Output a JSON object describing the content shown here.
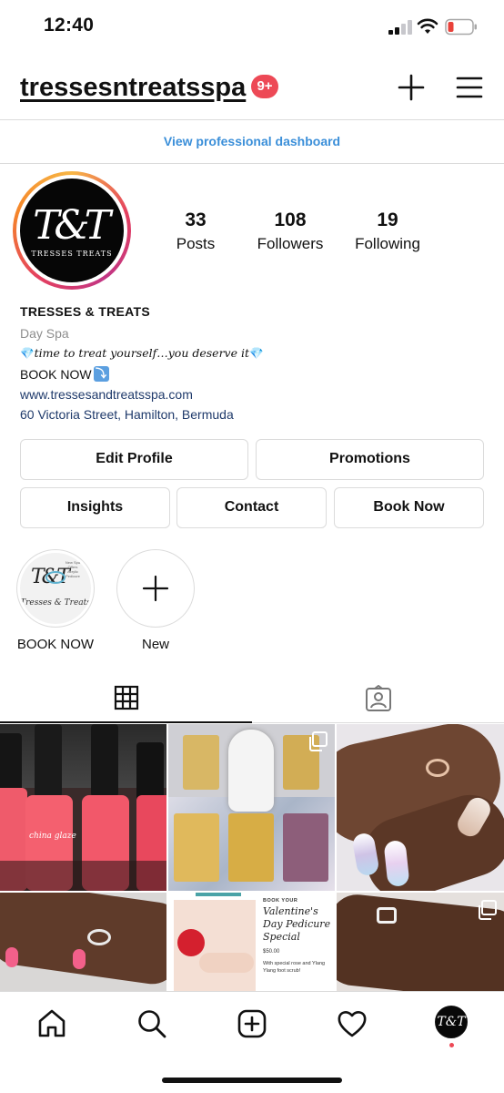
{
  "status_bar": {
    "time": "12:40"
  },
  "header": {
    "username": "tressesntreatsspa",
    "notification_badge": "9+",
    "accent": "#ed4956"
  },
  "dashboard_link": "View professional dashboard",
  "profile": {
    "logo_monogram": "T&T",
    "logo_wordmark": "TRESSES TREATS",
    "stats": [
      {
        "value": "33",
        "label": "Posts"
      },
      {
        "value": "108",
        "label": "Followers"
      },
      {
        "value": "19",
        "label": "Following"
      }
    ],
    "name": "TRESSES & TREATS",
    "category": "Day Spa",
    "tagline": "time to treat yourself…you deserve it",
    "cta_text": "BOOK NOW",
    "website": "www.tressesandtreatsspa.com",
    "address": "60 Victoria Street, Hamilton, Bermuda"
  },
  "buttons": {
    "edit_profile": "Edit Profile",
    "promotions": "Promotions",
    "insights": "Insights",
    "contact": "Contact",
    "book_now": "Book Now"
  },
  "highlights": [
    {
      "label": "BOOK NOW",
      "thumb_caption": "Tresses & Treats"
    },
    {
      "label": "New"
    }
  ],
  "tabs": [
    {
      "icon": "grid-icon",
      "active": true
    },
    {
      "icon": "tagged-icon",
      "active": false
    }
  ],
  "posts": [
    {
      "content": "pink nail polish bottles",
      "brand": "china glaze",
      "multi": false
    },
    {
      "content": "spa products with buddha statue",
      "multi": true
    },
    {
      "content": "manicured nails with rings",
      "multi": false
    },
    {
      "content": "hand with ring",
      "multi": false
    },
    {
      "content": "valentine's day pedicure ad",
      "kicker": "BOOK YOUR",
      "title": "Valentine's Day Pedicure Special",
      "price": "$50.00",
      "desc": "With special rose and Ylang Ylang foot scrub!",
      "multi": false
    },
    {
      "content": "hands with diamond ring",
      "multi": true
    }
  ],
  "bottom_nav": [
    "home-icon",
    "search-icon",
    "create-icon",
    "activity-icon",
    "profile-icon"
  ]
}
